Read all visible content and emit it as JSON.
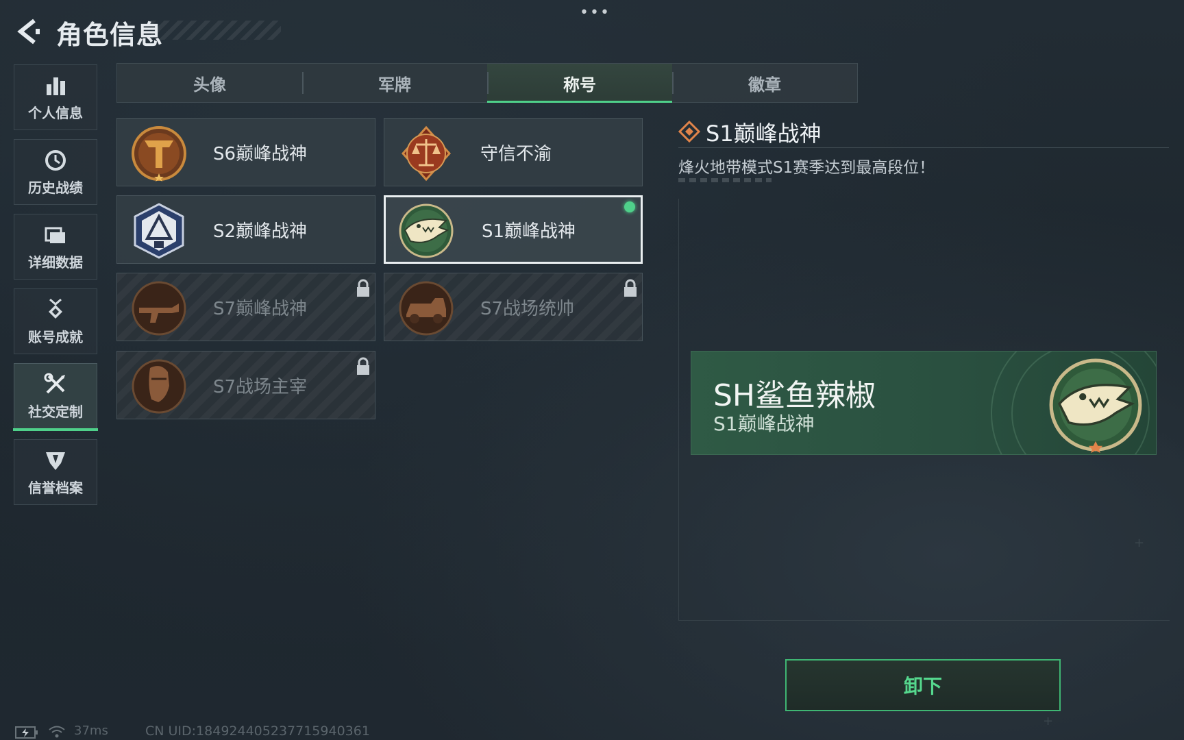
{
  "header": {
    "title": "角色信息",
    "more_label": "•••"
  },
  "sidebar": {
    "items": [
      {
        "label": "个人信息",
        "icon": "bar-chart-icon",
        "active": false
      },
      {
        "label": "历史战绩",
        "icon": "history-clock-icon",
        "active": false
      },
      {
        "label": "详细数据",
        "icon": "folder-icon",
        "active": false
      },
      {
        "label": "账号成就",
        "icon": "achievement-medal-icon",
        "active": false
      },
      {
        "label": "社交定制",
        "icon": "tools-icon",
        "active": true
      },
      {
        "label": "信誉档案",
        "icon": "reputation-shield-icon",
        "active": false
      }
    ]
  },
  "tabs": [
    {
      "label": "头像",
      "active": false
    },
    {
      "label": "军牌",
      "active": false
    },
    {
      "label": "称号",
      "active": true
    },
    {
      "label": "徽章",
      "active": false
    }
  ],
  "titles": [
    {
      "name": "S6巅峰战神",
      "badge": "s6-badge-icon",
      "locked": false,
      "selected": false
    },
    {
      "name": "守信不渝",
      "badge": "scales-badge-icon",
      "locked": false,
      "selected": false
    },
    {
      "name": "S2巅峰战神",
      "badge": "s2-badge-icon",
      "locked": false,
      "selected": false
    },
    {
      "name": "S1巅峰战神",
      "badge": "crocodile-badge-icon",
      "locked": false,
      "selected": true,
      "equipped": true
    },
    {
      "name": "S7巅峰战神",
      "badge": "rifle-badge-icon",
      "locked": true,
      "selected": false
    },
    {
      "name": "S7战场统帅",
      "badge": "vehicle-badge-icon",
      "locked": true,
      "selected": false
    },
    {
      "name": "S7战场主宰",
      "badge": "soldier-badge-icon",
      "locked": true,
      "selected": false
    }
  ],
  "detail": {
    "title": "S1巅峰战神",
    "description": "烽火地带模式S1赛季达到最高段位！"
  },
  "preview": {
    "player_name": "SH鲨鱼辣椒",
    "title": "S1巅峰战神",
    "badge": "crocodile-badge-icon"
  },
  "actions": {
    "unequip_label": "卸下"
  },
  "footer": {
    "ping": "37ms",
    "uid": "CN UID:1849244052377159403​61"
  },
  "colors": {
    "accent_green": "#4fd08a",
    "banner_green": "#2f5a45",
    "detail_icon_orange": "#e0844a"
  }
}
